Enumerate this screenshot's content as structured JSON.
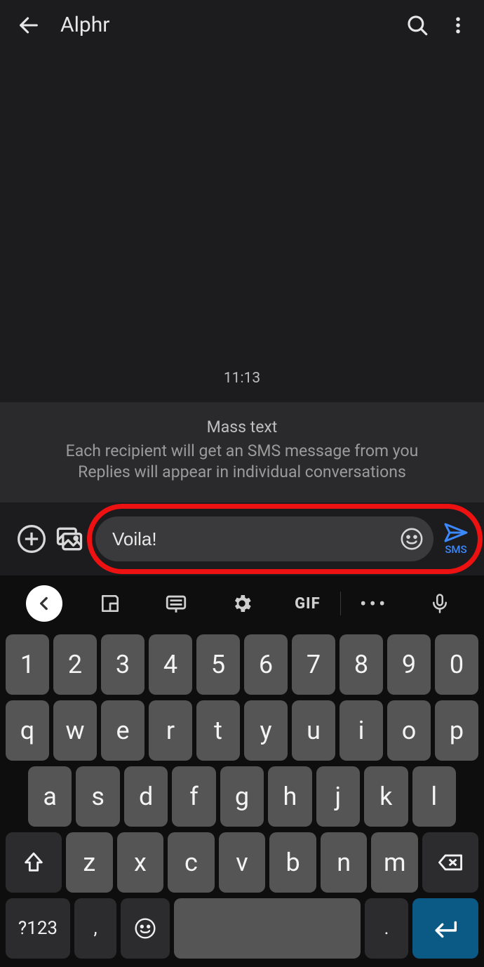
{
  "header": {
    "title": "Alphr",
    "back_icon": "arrow-back",
    "search_icon": "search",
    "more_icon": "more-vertical"
  },
  "conversation": {
    "timestamp": "11:13",
    "notice_title": "Mass text",
    "notice_line1": "Each recipient will get an SMS message from you",
    "notice_line2": "Replies will appear in individual conversations"
  },
  "compose": {
    "plus_icon": "plus-circle",
    "gallery_icon": "image-gallery",
    "message_text": "Voila!",
    "emoji_icon": "emoji-smile",
    "send_icon": "send",
    "send_label": "SMS"
  },
  "keyboard": {
    "strip": {
      "collapse_icon": "chevron-left",
      "sticker_icon": "sticker",
      "clipboard_icon": "keyboard-panel",
      "settings_icon": "gear",
      "gif_label": "GIF",
      "more_icon": "dots-horizontal",
      "mic_icon": "microphone"
    },
    "row1": [
      "1",
      "2",
      "3",
      "4",
      "5",
      "6",
      "7",
      "8",
      "9",
      "0"
    ],
    "row2": [
      "q",
      "w",
      "e",
      "r",
      "t",
      "y",
      "u",
      "i",
      "o",
      "p"
    ],
    "row3": [
      "a",
      "s",
      "d",
      "f",
      "g",
      "h",
      "j",
      "k",
      "l"
    ],
    "row4": [
      "z",
      "x",
      "c",
      "v",
      "b",
      "n",
      "m"
    ],
    "shift_icon": "shift",
    "backspace_icon": "backspace",
    "sym_label": "?123",
    "comma_label": ",",
    "emoji_icon": "emoji-smile",
    "period_label": ".",
    "enter_icon": "enter"
  },
  "colors": {
    "bg": "#1c1c1e",
    "key": "#555555",
    "key_dark": "#2c2c2e",
    "accent": "#3b88ff",
    "highlight": "#ee1111",
    "enter": "#0b5a86"
  }
}
